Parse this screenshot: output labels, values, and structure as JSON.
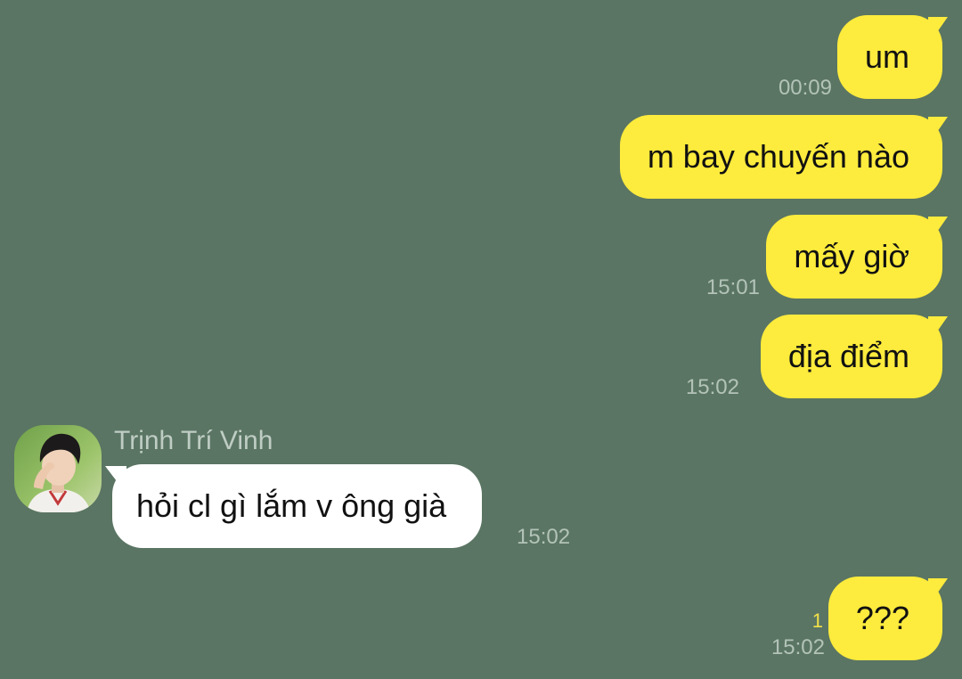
{
  "conversation": {
    "messages": [
      {
        "direction": "outgoing",
        "text": "um",
        "time": "00:09"
      },
      {
        "direction": "outgoing",
        "text": "m bay chuyến nào",
        "time": ""
      },
      {
        "direction": "outgoing",
        "text": "mấy giờ",
        "time": "15:01"
      },
      {
        "direction": "outgoing",
        "text": "địa điểm",
        "time": "15:02"
      },
      {
        "direction": "incoming",
        "sender": "Trịnh Trí Vinh",
        "avatar_icon": "user-avatar-photo",
        "text": "hỏi cl gì lắm v ông già",
        "time": "15:02"
      },
      {
        "direction": "outgoing",
        "text": "???",
        "time": "15:02",
        "unread_count": "1"
      }
    ]
  },
  "colors": {
    "background": "#5a7563",
    "outgoing_bubble": "#fdeb3d",
    "incoming_bubble": "#ffffff",
    "timestamp": "#b3c3b8",
    "unread_counter": "#f3e04a"
  }
}
